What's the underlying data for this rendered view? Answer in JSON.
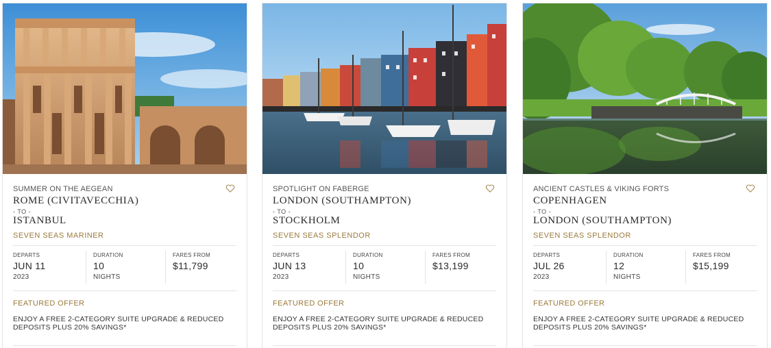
{
  "cards": [
    {
      "subtitle": "SUMMER ON THE AEGEAN",
      "from": "ROME (CIVITAVECCHIA)",
      "to_label": "- TO -",
      "to": "ISTANBUL",
      "ship": "SEVEN SEAS MARINER",
      "departs_label": "DEPARTS",
      "departs_date": "JUN 11",
      "departs_year": "2023",
      "duration_label": "DURATION",
      "duration_value": "10",
      "duration_unit": "NIGHTS",
      "fares_label": "FARES FROM",
      "fares_value": "$11,799",
      "featured_label": "FEATURED OFFER",
      "offer_text": "ENJOY A FREE 2-CATEGORY SUITE UPGRADE & REDUCED DEPOSITS PLUS 20% SAVINGS*",
      "image": "library-of-celsus-ephesus-ruins-photo"
    },
    {
      "subtitle": "SPOTLIGHT ON FABERGE",
      "from": "LONDON (SOUTHAMPTON)",
      "to_label": "- TO -",
      "to": "STOCKHOLM",
      "ship": "SEVEN SEAS SPLENDOR",
      "departs_label": "DEPARTS",
      "departs_date": "JUN 13",
      "departs_year": "2023",
      "duration_label": "DURATION",
      "duration_value": "10",
      "duration_unit": "NIGHTS",
      "fares_label": "FARES FROM",
      "fares_value": "$13,199",
      "featured_label": "FEATURED OFFER",
      "offer_text": "ENJOY A FREE 2-CATEGORY SUITE UPGRADE & REDUCED DEPOSITS PLUS 20% SAVINGS*",
      "image": "nyhavn-harbor-colorful-houses-boats-photo"
    },
    {
      "subtitle": "ANCIENT CASTLES & VIKING FORTS",
      "from": "COPENHAGEN",
      "to_label": "- TO -",
      "to": "LONDON (SOUTHAMPTON)",
      "ship": "SEVEN SEAS SPLENDOR",
      "departs_label": "DEPARTS",
      "departs_date": "JUL 26",
      "departs_year": "2023",
      "duration_label": "DURATION",
      "duration_value": "12",
      "duration_unit": "NIGHTS",
      "fares_label": "FARES FROM",
      "fares_value": "$15,199",
      "featured_label": "FEATURED OFFER",
      "offer_text": "ENJOY A FREE 2-CATEGORY SUITE UPGRADE & REDUCED DEPOSITS PLUS 20% SAVINGS*",
      "image": "park-lake-white-bridge-trees-photo"
    }
  ],
  "colors": {
    "accent_gold": "#9a7a3c",
    "border": "#e2e2e2",
    "text": "#2a2a2a"
  }
}
